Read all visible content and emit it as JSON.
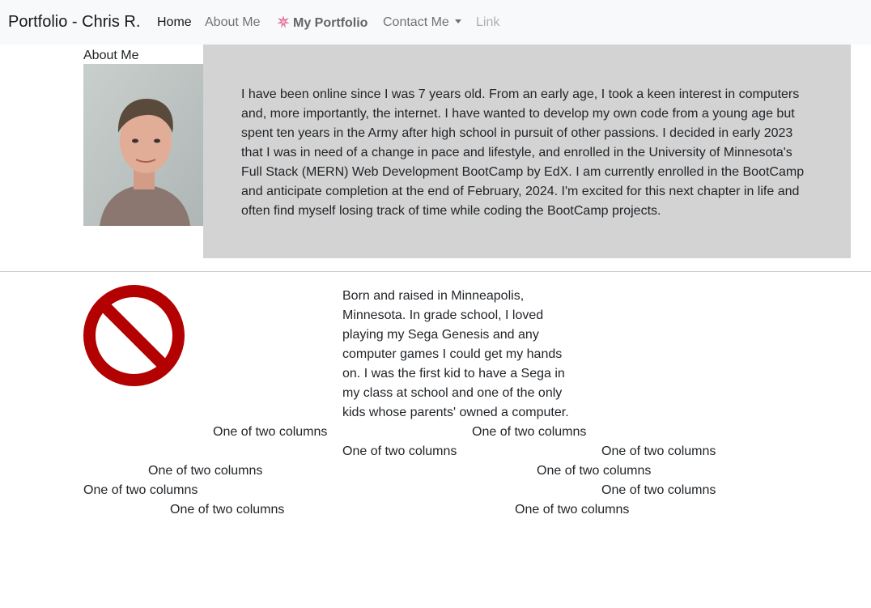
{
  "navbar": {
    "brand": "Portfolio - Chris R.",
    "links": [
      {
        "label": "Home"
      },
      {
        "label": "About Me"
      },
      {
        "label": "My Portfolio"
      },
      {
        "label": "Contact Me"
      },
      {
        "label": "Link"
      }
    ]
  },
  "about": {
    "heading": "About Me",
    "bio": "I have been online since I was 7 years old. From an early age, I took a keen interest in computers and, more importantly, the internet. I have wanted to develop my own code from a young age but spent ten years in the Army after high school in pursuit of other passions. I decided in early 2023 that I was in need of a change in pace and lifestyle, and enrolled in the University of Minnesota's Full Stack (MERN) Web Development BootCamp by EdX. I am currently enrolled in the BootCamp and anticipate completion at the end of February, 2024. I'm excited for this next chapter in life and often find myself losing track of time while coding the BootCamp projects."
  },
  "origin": {
    "text": "Born and raised in Minneapolis, Minnesota. In grade school, I loved playing my Sega Genesis and any computer games I could get my hands on. I was the first kid to have a Sega in my class at school and one of the only kids whose parents' owned a computer."
  },
  "columns": [
    "One of two columns",
    "One of two columns",
    "One of two columns",
    "One of two columns",
    "One of two columns",
    "One of two columns",
    "One of two columns",
    "One of two columns",
    "One of two columns",
    "One of two columns"
  ],
  "colors": {
    "navbar_bg": "#f8f9fa",
    "bio_bg": "#d3d3d3",
    "no_icon": "#b30000"
  }
}
